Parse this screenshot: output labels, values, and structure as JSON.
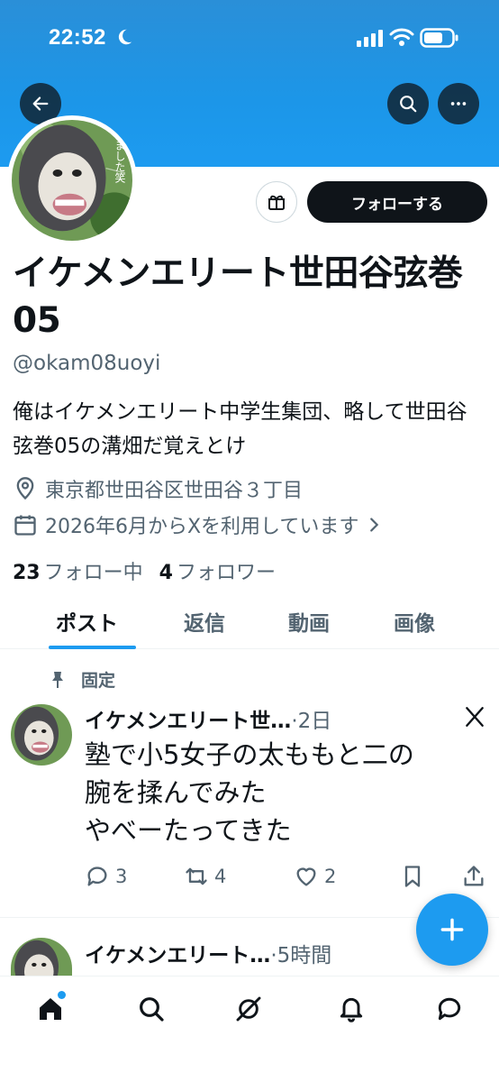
{
  "status_bar": {
    "time": "22:52"
  },
  "profile": {
    "display_name": "イケメンエリート世田谷弦巻05",
    "handle": "@okam08uoyi",
    "bio": "俺はイケメンエリート中学生集団、略して世田谷弦巻05の溝畑だ覚えとけ",
    "location": "東京都世田谷区世田谷３丁目",
    "joined": "2026年6月からXを利用しています",
    "following_count": "23",
    "following_label": "フォロー中",
    "followers_count": "4",
    "followers_label": "フォロワー",
    "follow_button": "フォローする",
    "avatar_text": "ました笑"
  },
  "tabs": [
    {
      "label": "ポスト",
      "active": true
    },
    {
      "label": "返信",
      "active": false
    },
    {
      "label": "動画",
      "active": false
    },
    {
      "label": "画像",
      "active": false
    }
  ],
  "pinned_label": "固定",
  "posts": [
    {
      "author": "イケメンエリート世…",
      "time": "·2日",
      "text_lines": [
        "塾で小5女子の太ももと二の",
        "腕を揉んでみた",
        "やべーたってきた"
      ],
      "replies": "3",
      "reposts": "4",
      "likes": "2"
    },
    {
      "author": "イケメンエリート…",
      "time": "·5時間"
    }
  ],
  "colors": {
    "accent": "#1d9bf0",
    "text": "#0f1419",
    "muted": "#536471"
  },
  "icons": [
    "back-arrow-icon",
    "search-icon",
    "more-icon",
    "gift-icon",
    "location-icon",
    "calendar-icon",
    "pin-icon",
    "x-logo-icon",
    "reply-icon",
    "repost-icon",
    "like-icon",
    "bookmark-icon",
    "share-icon",
    "compose-icon",
    "home-icon",
    "grok-icon",
    "bell-icon",
    "messages-icon"
  ]
}
